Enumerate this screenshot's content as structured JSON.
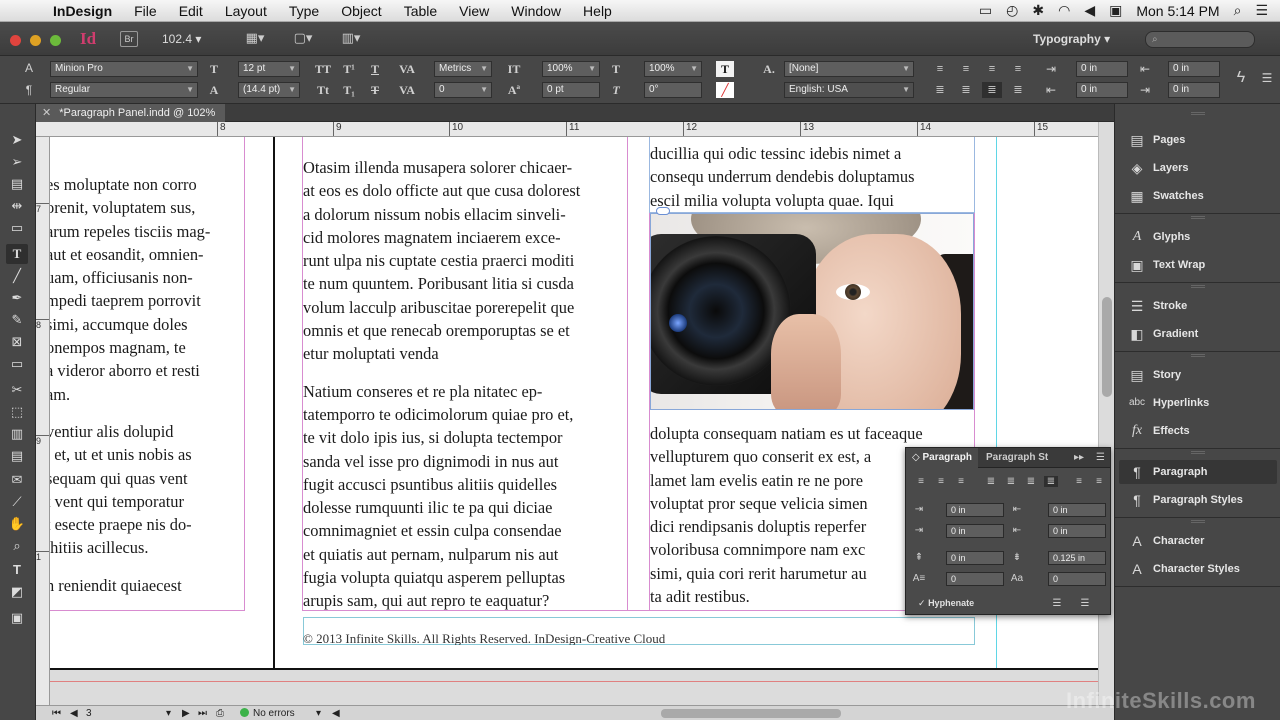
{
  "menubar": {
    "app": "InDesign",
    "items": [
      "File",
      "Edit",
      "Layout",
      "Type",
      "Object",
      "Table",
      "View",
      "Window",
      "Help"
    ],
    "clock": "Mon 5:14 PM"
  },
  "appbar": {
    "logo": "Id",
    "bridge": "Br",
    "zoom": "102.4",
    "workspace": "Typography"
  },
  "control": {
    "font_family": "Minion Pro",
    "font_style": "Regular",
    "font_size": "12 pt",
    "leading": "(14.4 pt)",
    "kerning": "Metrics",
    "tracking": "0",
    "vscale": "100%",
    "hscale": "100%",
    "baseline": "0 pt",
    "skew": "0°",
    "char_style": "[None]",
    "language": "English: USA",
    "indent_left": "0 in",
    "indent_right": "0 in",
    "indent_first": "0 in",
    "indent_last": "0 in"
  },
  "document": {
    "tab_title": "*Paragraph Panel.indd @ 102%",
    "ruler_ticks": [
      "8",
      "9",
      "10",
      "11",
      "12",
      "13",
      "14",
      "15"
    ],
    "vruler_ticks": [
      "7",
      "8",
      "9",
      "1"
    ]
  },
  "left_column": [
    "es moluptate non corro",
    "orenit, voluptatem sus,",
    "arum repeles tisciis mag-",
    "aut et eosandit, omnien-",
    "uam, officiusanis non-",
    "mpedi taeprem porrovit",
    "simi, accumque doles",
    "onempos magnam, te",
    "a videror aborro et resti",
    "am.",
    "",
    "ventiur alis dolupid",
    ", et, ut et unis nobis as",
    "sequam qui quas vent",
    "t vent qui temporatur",
    "t esecte praepe nis do-",
    " hitiis acillecus.",
    "",
    "n reniendit quiaecest"
  ],
  "middle_column": [
    "Otasim illenda musapera solorer chicaer-",
    "at eos es dolo officte aut que cusa dolorest",
    "a dolorum nissum nobis ellacim sinveli-",
    "cid molores magnatem inciaerem exce-",
    "runt ulpa nis cuptate cestia praerci moditi",
    "te num quuntem. Poribusant litia si cusda",
    "volum lacculp aribuscitae porerepelit que",
    "omnis et que renecab oremporuptas se et",
    "etur moluptati venda",
    "",
    "Natium conseres et re pla nitatec ep-",
    "tatemporro te odicimolorum quiae pro et,",
    "te vit dolo ipis ius, si dolupta tectempor",
    "sanda vel isse pro dignimodi in nus aut",
    "fugit accusci psuntibus alitiis quidelles",
    "dolesse rumquunti ilic te pa qui diciae",
    "comnimagniet et essin culpa consendae",
    "et quiatis aut pernam, nulparum nis aut",
    "fugia volupta quiatqu asperem pelluptas",
    "arupis sam, qui aut repro te eaquatur?"
  ],
  "right_column_top": [
    "ducillia qui odic tessinc idebis nimet a",
    "consequ underrum dendebis doluptamus",
    "escil milia volupta volupta quae. Iqui"
  ],
  "right_column_bottom": [
    "dolupta consequam natiam es ut faceaque",
    "vellupturem quo conserit ex est, a",
    "lamet lam evelis eatin re ne pore",
    "voluptat pror seque velicia simen",
    "dici rendipsanis doluptis reperfer",
    "voloribusa comnimpore nam exc",
    "simi, quia cori rerit harumetur au",
    "ta adit restibus."
  ],
  "footer": "© 2013 Infinite Skills. All Rights Reserved. InDesign-Creative Cloud",
  "dock": {
    "groups": [
      [
        "Pages",
        "Layers",
        "Swatches"
      ],
      [
        "Glyphs",
        "Text Wrap"
      ],
      [
        "Stroke",
        "Gradient"
      ],
      [
        "Story",
        "Hyperlinks",
        "Effects"
      ],
      [
        "Paragraph",
        "Paragraph Styles"
      ],
      [
        "Character",
        "Character Styles"
      ]
    ]
  },
  "paragraph_panel": {
    "tab_active": "Paragraph",
    "tab_other": "Paragraph St",
    "left_indent": "0 in",
    "right_indent": "0 in",
    "first_indent": "0 in",
    "last_indent": "0 in",
    "space_before": "0 in",
    "space_after": "0.125 in",
    "drop_lines": "0",
    "drop_chars": "0",
    "hyphenate": "Hyphenate"
  },
  "statusbar": {
    "page": "3",
    "preflight": "No errors"
  },
  "watermark": "InfiniteSkills.com"
}
